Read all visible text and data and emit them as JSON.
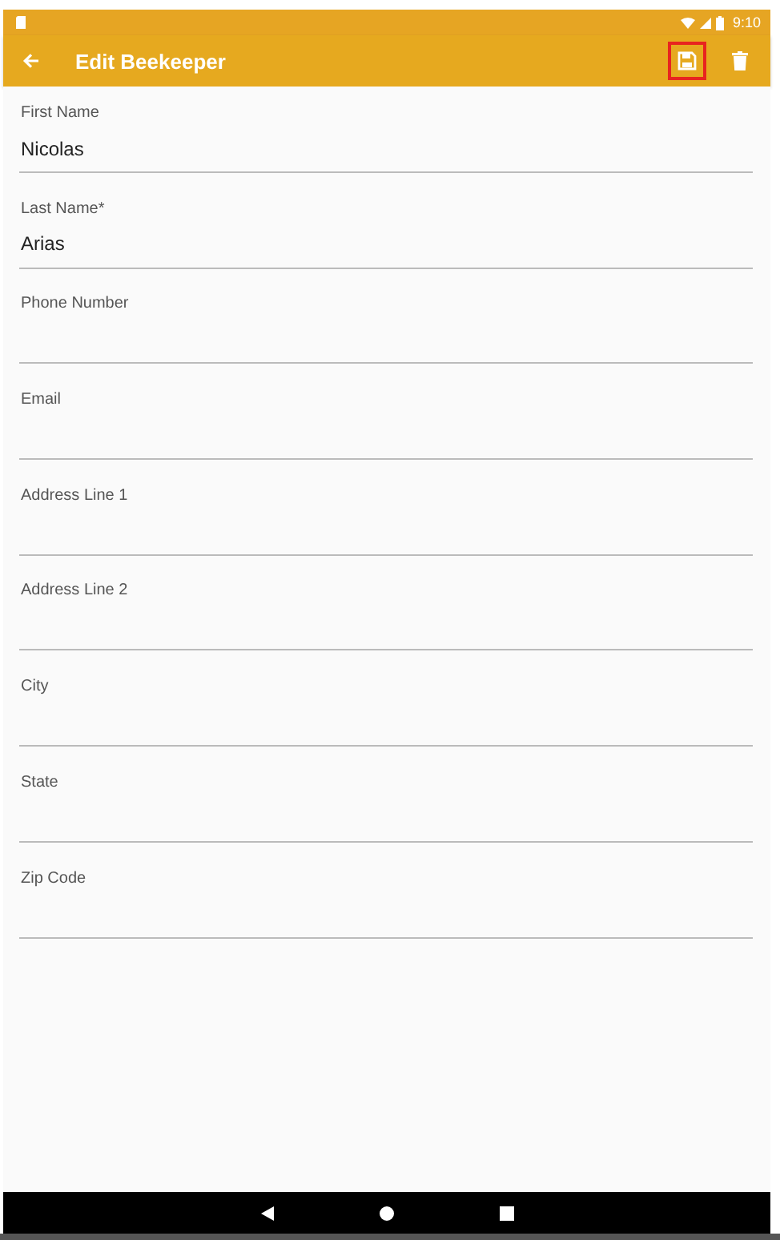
{
  "status_bar": {
    "time": "9:10"
  },
  "app_bar": {
    "title": "Edit Beekeeper",
    "actions": [
      {
        "kind": "save",
        "highlighted": true
      },
      {
        "kind": "delete",
        "highlighted": false
      }
    ]
  },
  "fields": [
    {
      "label": "First Name",
      "value": "Nicolas"
    },
    {
      "label": "Last Name*",
      "value": "Arias"
    },
    {
      "label": "Phone Number"
    },
    {
      "label": "Email"
    },
    {
      "label": "Address Line 1"
    },
    {
      "label": "Address Line 2"
    },
    {
      "label": "City"
    },
    {
      "label": "State"
    },
    {
      "label": "Zip Code"
    }
  ]
}
